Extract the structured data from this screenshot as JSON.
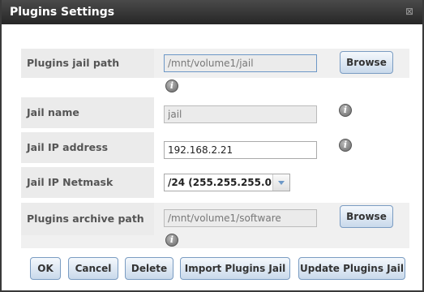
{
  "dialog": {
    "title": "Plugins Settings",
    "close_icon": "close-x-icon"
  },
  "fields": {
    "jail_path": {
      "label": "Plugins jail path",
      "value": "/mnt/volume1/jail",
      "browse_label": "Browse"
    },
    "jail_name": {
      "label": "Jail name",
      "value": "jail"
    },
    "jail_ip": {
      "label": "Jail IP address",
      "value": "192.168.2.21"
    },
    "jail_netmask": {
      "label": "Jail IP Netmask",
      "value": "/24 (255.255.255.0)"
    },
    "archive_path": {
      "label": "Plugins archive path",
      "value": "/mnt/volume1/software",
      "browse_label": "Browse"
    }
  },
  "buttons": {
    "ok": "OK",
    "cancel": "Cancel",
    "delete": "Delete",
    "import": "Import Plugins Jail",
    "update": "Update Plugins Jail"
  },
  "info_icon_glyph": "i"
}
